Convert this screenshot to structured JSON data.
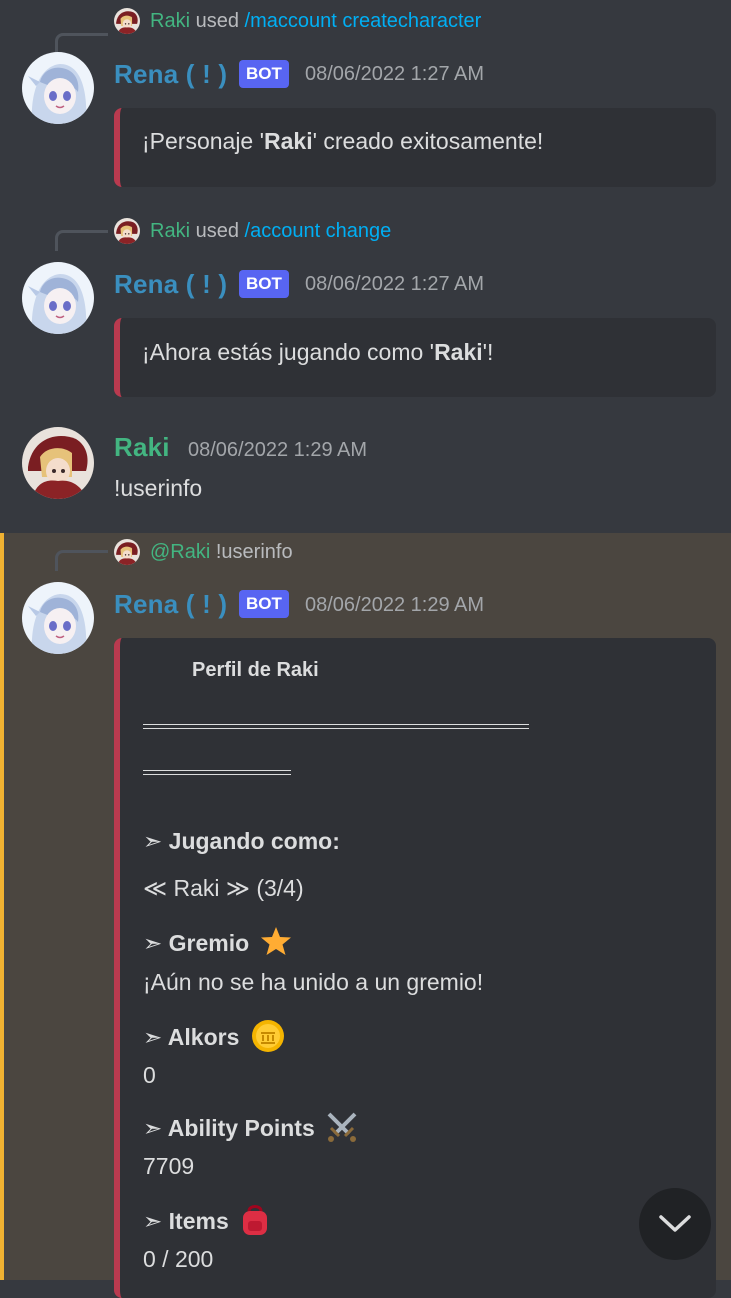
{
  "messages": [
    {
      "reply": {
        "name": "Raki",
        "used": "used",
        "command": "/maccount createcharacter"
      },
      "author": "Rena ( ! )",
      "badge": "BOT",
      "timestamp": "08/06/2022 1:27 AM",
      "embed": {
        "pre": "¡Personaje '",
        "bold": "Raki",
        "post": "' creado exitosamente!"
      }
    },
    {
      "reply": {
        "name": "Raki",
        "used": "used",
        "command": "/account change"
      },
      "author": "Rena ( ! )",
      "badge": "BOT",
      "timestamp": "08/06/2022 1:27 AM",
      "embed": {
        "pre": "¡Ahora estás jugando como '",
        "bold": "Raki",
        "post": "'!"
      }
    },
    {
      "author": "Raki",
      "timestamp": "08/06/2022 1:29 AM",
      "content": "!userinfo"
    },
    {
      "reply": {
        "name": "@Raki",
        "command": "!userinfo"
      },
      "author": "Rena ( ! )",
      "badge": "BOT",
      "timestamp": "08/06/2022 1:29 AM",
      "embed": {
        "title": "Perfil de Raki",
        "playing_label": "➣ Jugando como:",
        "playing_value": "≪ Raki ≫  (3/4)",
        "guild_label": "➣ Gremio",
        "guild_value": "¡Aún no se ha unido a un gremio!",
        "alkors_label": "➣ Alkors",
        "alkors_value": "0",
        "ability_label": "➣ Ability Points",
        "ability_value": "7709",
        "items_label": "➣ Items",
        "items_value": "0 / 200"
      }
    }
  ],
  "icons": {
    "star": "star-icon",
    "coin": "coin-icon",
    "swords": "crossed-swords-icon",
    "backpack": "backpack-icon",
    "scroll": "chevron-down-icon"
  },
  "colors": {
    "background": "#36393f",
    "highlight": "#4b4640",
    "highlight_bar": "#f0b232",
    "embed_bar": "#b93a4f",
    "bot_badge": "#5865f2",
    "raki_green": "#43b581",
    "command_blue": "#00aff4"
  }
}
